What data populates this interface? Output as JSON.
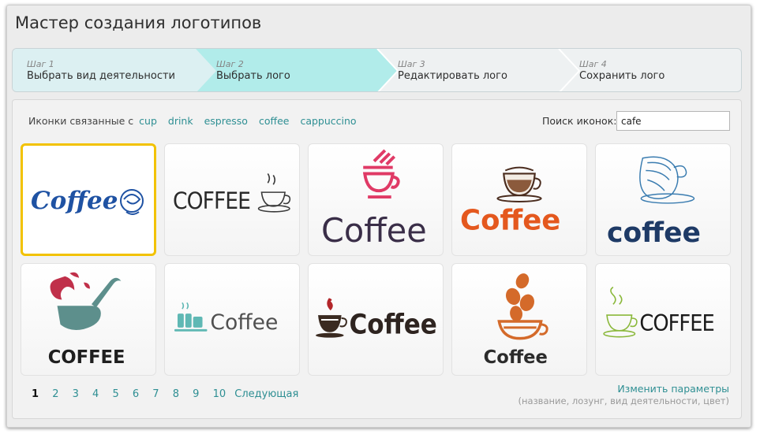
{
  "window": {
    "title": "Мастер создания логотипов"
  },
  "steps": [
    {
      "num": "Шаг 1",
      "name": "Выбрать вид деятельности",
      "state": "done"
    },
    {
      "num": "Шаг 2",
      "name": "Выбрать лого",
      "state": "active"
    },
    {
      "num": "Шаг 3",
      "name": "Редактировать лого",
      "state": "todo"
    },
    {
      "num": "Шаг 4",
      "name": "Сохранить лого",
      "state": "todo"
    }
  ],
  "related": {
    "label": "Иконки связанные с",
    "tags": [
      "cup",
      "drink",
      "espresso",
      "coffee",
      "cappuccino"
    ]
  },
  "search": {
    "label": "Поиск иконок:",
    "value": "cafe"
  },
  "logos": [
    {
      "text": "Coffee",
      "icon": "coffee-cup-swirl-icon",
      "selected": true
    },
    {
      "text": "COFFEE",
      "icon": "coffee-cup-steam-sketch-icon"
    },
    {
      "text": "Coffee",
      "icon": "cocktail-glass-straws-icon"
    },
    {
      "text": "Coffee",
      "icon": "espresso-cup-brown-icon"
    },
    {
      "text": "coffee",
      "icon": "teacup-sketch-icon"
    },
    {
      "text": "COFFEE",
      "icon": "abstract-splash-cup-icon"
    },
    {
      "text": "Coffee",
      "icon": "cup-stack-teal-icon"
    },
    {
      "text": "Coffee",
      "icon": "cup-red-drop-icon"
    },
    {
      "text": "Coffee",
      "icon": "coffee-beans-cup-icon"
    },
    {
      "text": "COFFEE",
      "icon": "green-cup-steam-icon"
    }
  ],
  "pagination": {
    "current": "1",
    "pages": [
      "2",
      "3",
      "4",
      "5",
      "6",
      "7",
      "8",
      "9",
      "10"
    ],
    "next_label": "Следующая"
  },
  "params": {
    "link": "Изменить параметры",
    "hint": "(название, лозунг, вид деятельности, цвет)"
  },
  "colors": {
    "accent": "#2e8f93",
    "step_done": "#dcf0f2",
    "step_active": "#b1ecea",
    "selection": "#f2c200"
  }
}
